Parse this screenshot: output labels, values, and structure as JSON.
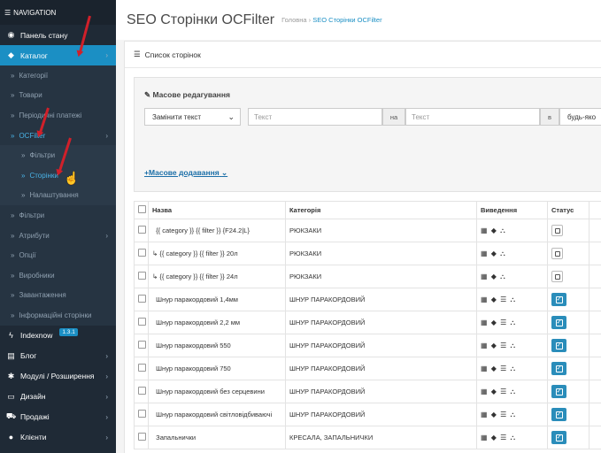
{
  "sidebar": {
    "header": "NAVIGATION",
    "items": [
      {
        "label": "Панель стану",
        "icon": "dashboard-icon"
      },
      {
        "label": "Каталог",
        "icon": "tag-icon"
      },
      {
        "label": "Категорії"
      },
      {
        "label": "Товари"
      },
      {
        "label": "Періодичні платежі"
      },
      {
        "label": "OCFilter"
      },
      {
        "label": "Фільтри"
      },
      {
        "label": "Сторінки"
      },
      {
        "label": "Налаштування"
      },
      {
        "label": "Фільтри"
      },
      {
        "label": "Атрибути"
      },
      {
        "label": "Опції"
      },
      {
        "label": "Виробники"
      },
      {
        "label": "Завантаження"
      },
      {
        "label": "Інформаційні сторінки"
      },
      {
        "label": "Indexnow",
        "icon": "bolt-icon",
        "badge": "1.3.1"
      },
      {
        "label": "Блог",
        "icon": "list-icon"
      },
      {
        "label": "Модулі / Розширення",
        "icon": "puzzle-icon"
      },
      {
        "label": "Дизайн",
        "icon": "monitor-icon"
      },
      {
        "label": "Продажі",
        "icon": "cart-icon"
      },
      {
        "label": "Клієнти",
        "icon": "user-icon"
      }
    ]
  },
  "page": {
    "title": "SEO Сторінки OCFilter",
    "breadcrumb_home": "Головна",
    "breadcrumb_current": "SEO Сторінки OCFilter"
  },
  "panel": {
    "heading": "Список сторінок",
    "mass_title": "Масове редагування",
    "action_select": "Замінити текст",
    "text_placeholder_1": "Текст",
    "on_label": "на",
    "text_placeholder_2": "Текст",
    "in_label": "в",
    "field_select": "будь-яко",
    "mass_add": "Масове додавання"
  },
  "table": {
    "headers": [
      "Назва",
      "Категорія",
      "Виведення",
      "Статус"
    ],
    "rows": [
      {
        "name": "{{ category }} {{ filter }} {F24.2|L}",
        "category": "РЮКЗАКИ",
        "status": false,
        "indent": false,
        "outputs": "▦ ◆ ⛬"
      },
      {
        "name": "{{ category }} {{ filter }} 20л",
        "category": "РЮКЗАКИ",
        "status": false,
        "indent": true,
        "outputs": "▦ ◆ ⛬"
      },
      {
        "name": "{{ category }} {{ filter }} 24л",
        "category": "РЮКЗАКИ",
        "status": false,
        "indent": true,
        "outputs": "▦ ◆ ⛬"
      },
      {
        "name": "Шнур паракордовий 1,4мм",
        "category": "ШНУР ПАРАКОРДОВИЙ",
        "status": true,
        "indent": false,
        "outputs": "▦ ◆ ☰ ⛬"
      },
      {
        "name": "Шнур паракордовий 2,2 мм",
        "category": "ШНУР ПАРАКОРДОВИЙ",
        "status": true,
        "indent": false,
        "outputs": "▦ ◆ ☰ ⛬"
      },
      {
        "name": "Шнур паракордовий 550",
        "category": "ШНУР ПАРАКОРДОВИЙ",
        "status": true,
        "indent": false,
        "outputs": "▦ ◆ ☰ ⛬"
      },
      {
        "name": "Шнур паракордовий 750",
        "category": "ШНУР ПАРАКОРДОВИЙ",
        "status": true,
        "indent": false,
        "outputs": "▦ ◆ ☰ ⛬"
      },
      {
        "name": "Шнур паракордовий без серцевини",
        "category": "ШНУР ПАРАКОРДОВИЙ",
        "status": true,
        "indent": false,
        "outputs": "▦ ◆ ☰ ⛬"
      },
      {
        "name": "Шнур паракордовий світловідбиваючі",
        "category": "ШНУР ПАРАКОРДОВИЙ",
        "status": true,
        "indent": false,
        "outputs": "▦ ◆ ☰ ⛬"
      },
      {
        "name": "Запальнички",
        "category": "КРЕСАЛА, ЗАПАЛЬНИЧКИ",
        "status": true,
        "indent": false,
        "outputs": "▦ ◆ ☰ ⛬"
      }
    ]
  },
  "colors": {
    "accent": "#1b8fc4",
    "sidebar": "#1f2a36",
    "annotation_arrow": "#d0202a"
  }
}
